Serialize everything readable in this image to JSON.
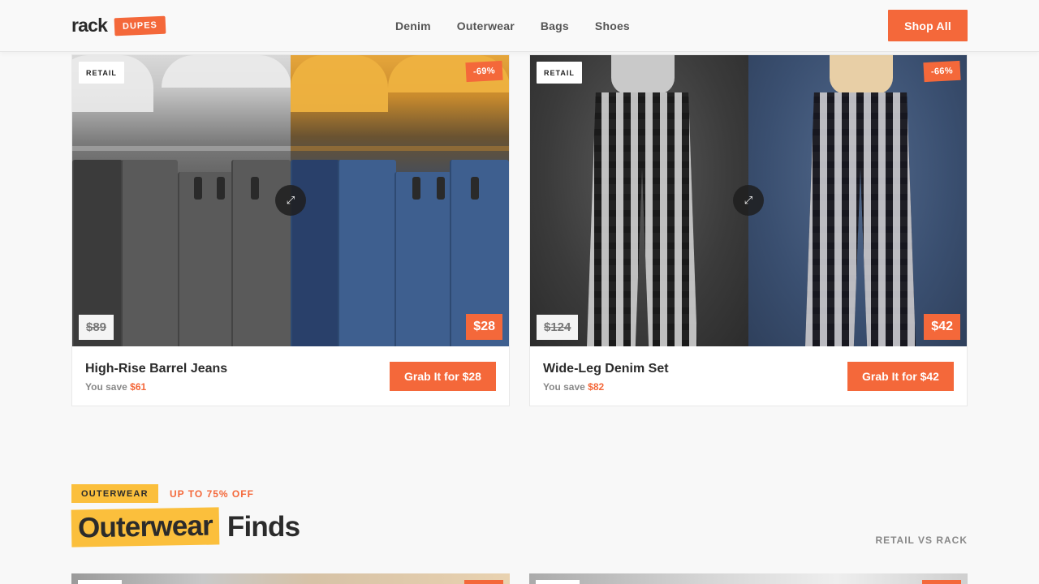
{
  "header": {
    "logo": "rack",
    "logo_badge": "DUPES",
    "nav": [
      "Denim",
      "Outerwear",
      "Bags",
      "Shoes"
    ],
    "shop_all": "Shop All"
  },
  "products": [
    {
      "retail_tag": "RETAIL",
      "discount": "-69%",
      "old_price": "$89",
      "new_price": "$28",
      "title": "High-Rise Barrel Jeans",
      "save_label": "You save",
      "save_amount": "$61",
      "cta": "Grab It for $28"
    },
    {
      "retail_tag": "RETAIL",
      "discount": "-66%",
      "old_price": "$124",
      "new_price": "$42",
      "title": "Wide-Leg Denim Set",
      "save_label": "You save",
      "save_amount": "$82",
      "cta": "Grab It for $42"
    }
  ],
  "section": {
    "tag": "OUTERWEAR",
    "subtitle": "UP TO 75% OFF",
    "title_highlight": "Outerwear",
    "title_rest": "Finds",
    "compare_label": "RETAIL VS RACK"
  },
  "icons": {
    "expand": "expand-icon"
  },
  "colors": {
    "accent": "#f4683a",
    "highlight": "#fbbf3c",
    "text": "#2b2b2b"
  }
}
